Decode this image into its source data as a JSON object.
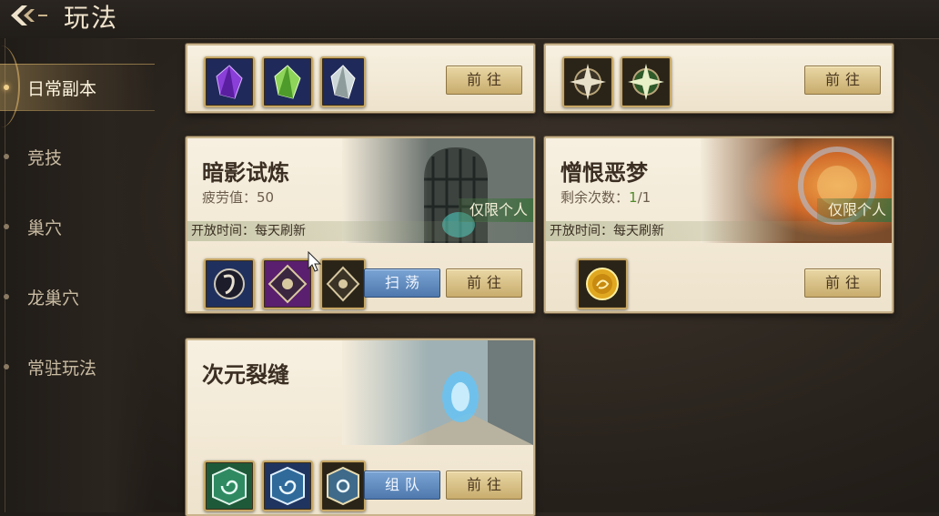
{
  "header": {
    "title": "玩法"
  },
  "sidebar": {
    "items": [
      {
        "label": "日常副本",
        "active": true
      },
      {
        "label": "竞技",
        "active": false
      },
      {
        "label": "巢穴",
        "active": false
      },
      {
        "label": "龙巢穴",
        "active": false
      },
      {
        "label": "常驻玩法",
        "active": false
      }
    ]
  },
  "cards": {
    "top_left": {
      "go": "前往",
      "icons": [
        "purple-crystal-icon",
        "green-crystal-icon",
        "silver-crystal-icon"
      ]
    },
    "top_right": {
      "go": "前往",
      "icons": [
        "dark-compass-icon",
        "green-compass-icon"
      ]
    },
    "shadow_trial": {
      "title": "暗影试炼",
      "fatigue_label": "疲劳值：",
      "fatigue_value": "50",
      "tag": "仅限个人",
      "open_time": "开放时间：每天刷新",
      "sweep": "扫荡",
      "go": "前往",
      "icons": [
        "rune-scroll-icon",
        "purple-eye-sigil-icon",
        "gold-eye-sigil-icon"
      ]
    },
    "hateful_nightmare": {
      "title": "憎恨恶梦",
      "remaining_label": "剩余次数：",
      "remaining_value": "1",
      "remaining_total": "/1",
      "tag": "仅限个人",
      "open_time": "开放时间：每天刷新",
      "go": "前往",
      "icons": [
        "gold-dragon-coin-icon"
      ]
    },
    "dimension_rift": {
      "title": "次元裂缝",
      "team": "组队",
      "go": "前往",
      "icons": [
        "green-spiral-icon",
        "blue-spiral-icon",
        "gold-spiral-icon"
      ]
    }
  },
  "colors": {
    "accent_gold": "#c8ac6d",
    "tag_green": "#3c6e3c",
    "button_blue": "#4f79ad"
  }
}
